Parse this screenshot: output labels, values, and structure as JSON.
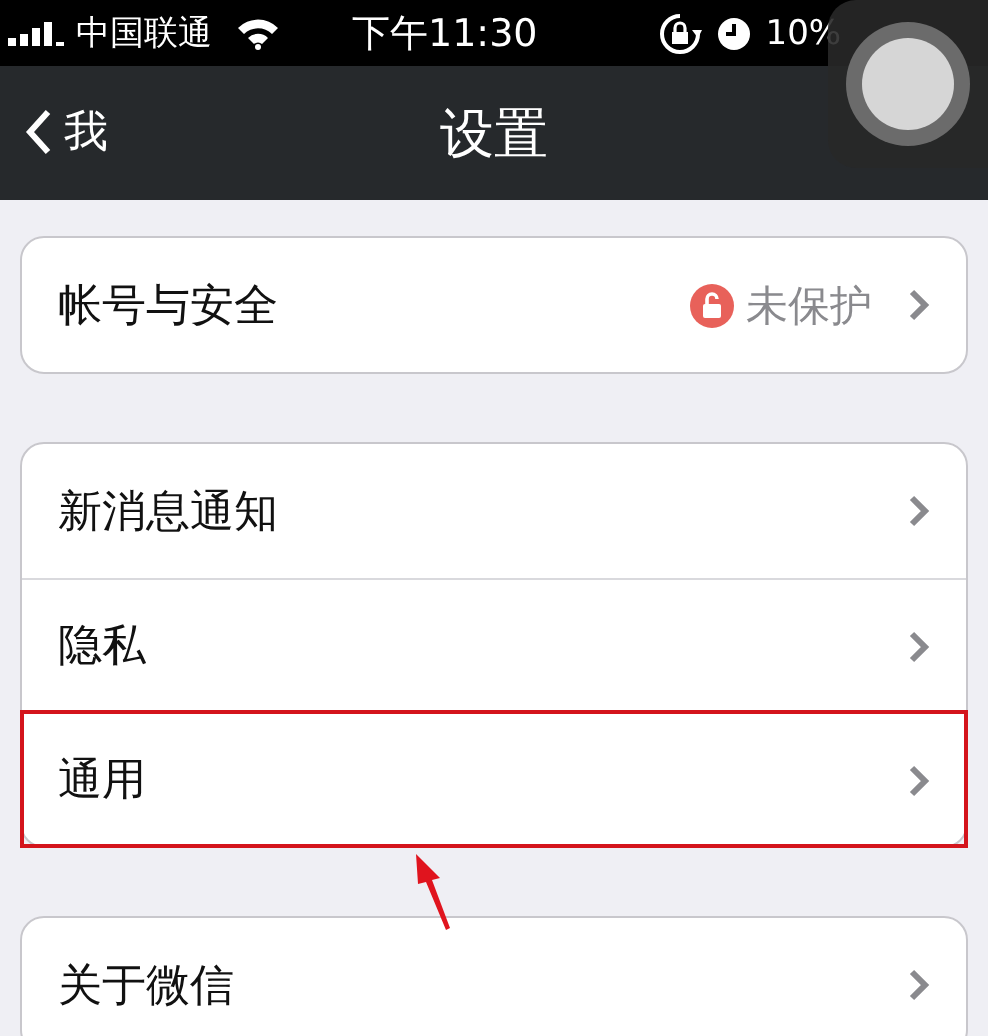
{
  "status_bar": {
    "carrier": "中国联通",
    "time": "下午11:30",
    "battery": "10%"
  },
  "nav_bar": {
    "back": "我",
    "title": "设置"
  },
  "groups": [
    {
      "items": [
        {
          "label": "帐号与安全",
          "status": "未保护",
          "highlighted": false
        }
      ]
    },
    {
      "items": [
        {
          "label": "新消息通知",
          "highlighted": false
        },
        {
          "label": "隐私",
          "highlighted": false
        },
        {
          "label": "通用",
          "highlighted": true
        }
      ]
    },
    {
      "items": [
        {
          "label": "关于微信",
          "highlighted": false
        }
      ]
    }
  ]
}
